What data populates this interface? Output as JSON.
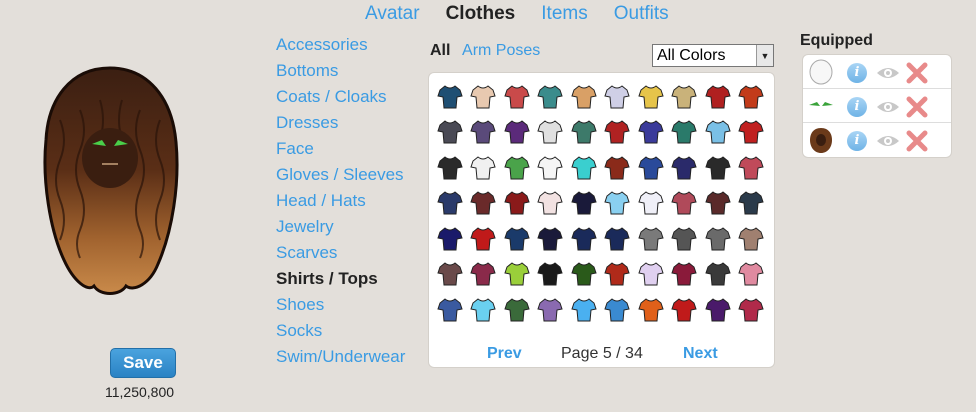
{
  "top_nav": {
    "tabs": [
      {
        "label": "Avatar",
        "active": false
      },
      {
        "label": "Clothes",
        "active": true
      },
      {
        "label": "Items",
        "active": false
      },
      {
        "label": "Outfits",
        "active": false
      }
    ]
  },
  "avatar": {
    "save_label": "Save",
    "money": "11,250,800"
  },
  "categories": [
    {
      "label": "Accessories",
      "active": false
    },
    {
      "label": "Bottoms",
      "active": false
    },
    {
      "label": "Coats / Cloaks",
      "active": false
    },
    {
      "label": "Dresses",
      "active": false
    },
    {
      "label": "Face",
      "active": false
    },
    {
      "label": "Gloves / Sleeves",
      "active": false
    },
    {
      "label": "Head / Hats",
      "active": false
    },
    {
      "label": "Jewelry",
      "active": false
    },
    {
      "label": "Scarves",
      "active": false
    },
    {
      "label": "Shirts / Tops",
      "active": true
    },
    {
      "label": "Shoes",
      "active": false
    },
    {
      "label": "Socks",
      "active": false
    },
    {
      "label": "Swim/Underwear",
      "active": false
    }
  ],
  "filters": {
    "all_label": "All",
    "arm_poses_label": "Arm Poses",
    "color_select": "All Colors"
  },
  "pager": {
    "prev_label": "Prev",
    "page_text": "Page 5 / 34",
    "next_label": "Next"
  },
  "equipped": {
    "title": "Equipped",
    "items": [
      {
        "name": "white-round-item",
        "color": "#f2f2f2"
      },
      {
        "name": "green-eyes",
        "color": "#3aa33a"
      },
      {
        "name": "brown-curly-hair",
        "color": "#6b3a1a"
      }
    ]
  },
  "grid_items": [
    "#1f4f73",
    "#e8c9b0",
    "#c94a4a",
    "#3b8c8c",
    "#d9a066",
    "#cfcfe6",
    "#e6c44a",
    "#c9b27a",
    "#b02020",
    "#c23b1a",
    "#4a4a55",
    "#5a4a7a",
    "#5b2a7a",
    "#e0e0e0",
    "#3d7a6a",
    "#b02222",
    "#3a3a9a",
    "#2a7a6a",
    "#7ac0e6",
    "#c02020",
    "#2a2a2a",
    "#f0f0f0",
    "#4aa34a",
    "#f5f5f5",
    "#3acfcf",
    "#8a2a1a",
    "#2a4a9a",
    "#2a2a6a",
    "#2a2a2a",
    "#c04a5a",
    "#2a3a6a",
    "#6a2a2a",
    "#8a1a1a",
    "#f2e2e2",
    "#1a1a3a",
    "#8ad0f0",
    "#f0f0f8",
    "#b04a5a",
    "#5a2a2a",
    "#2a3a4a",
    "#1a1a6a",
    "#c01a1a",
    "#1a3a6a",
    "#1a1a3a",
    "#1a2a5a",
    "#1a2a5a",
    "#7a7a7a",
    "#555555",
    "#6a6a6a",
    "#a08070",
    "#6a4a4a",
    "#8a2a4a",
    "#9acf3a",
    "#1a1a1a",
    "#2a5a1a",
    "#b02a1a",
    "#e0d0f0",
    "#8a1a3a",
    "#3a3a3a",
    "#e08aa0",
    "#3a5aa0",
    "#6ad0f0",
    "#3a6a3a",
    "#8a6ab0",
    "#4ab0f0",
    "#3a8ad0",
    "#e0601a",
    "#c01a1a",
    "#4a1a6a",
    "#b02a4a"
  ]
}
